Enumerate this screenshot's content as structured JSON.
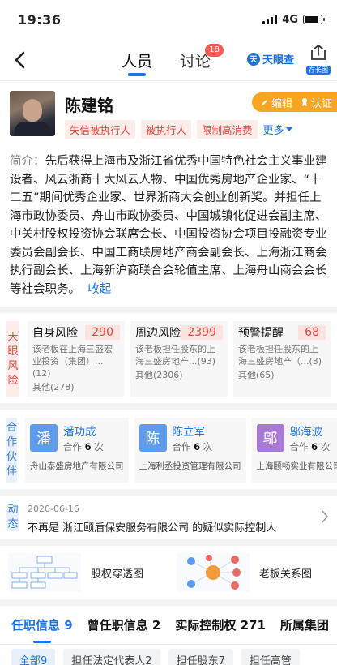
{
  "status": {
    "time": "19:36",
    "network": "4G",
    "battery_level": 0.85
  },
  "nav": {
    "tabs": [
      {
        "label": "人员",
        "active": true
      },
      {
        "label": "讨论",
        "badge": "18"
      }
    ],
    "brand": "天眼查",
    "longshot_label": "存长图"
  },
  "profile": {
    "name": "陈建铭",
    "actions": {
      "edit": "编辑",
      "verify": "认证"
    },
    "tags": [
      "失信被执行人",
      "被执行人",
      "限制高消费"
    ],
    "more": "更多",
    "bio_label": "简介：",
    "bio": "先后获得上海市及浙江省优秀中国特色社会主义事业建设者、风云浙商十大风云人物、中国优秀房地产企业家、“十二五”期间优秀企业家、世界浙商大会创业创新奖。并担任上海市政协委员、舟山市政协委员、中国城镇化促进会副主席、中关村股权投资协会联席会长、中国投资协会项目投融资专业委员会副会长、中国工商联房地产商会副会长、上海浙江商会执行副会长、上海新沪商联合会轮值主席、上海舟山商会会长等社会职务。",
    "collapse": "收起"
  },
  "risk": {
    "side_label": [
      "天",
      "眼",
      "风",
      "险"
    ],
    "items": [
      {
        "title": "自身风险",
        "count": "290",
        "desc": "该老板在上海三盛宏业投资（集团）...(12)",
        "other": "其他(278)"
      },
      {
        "title": "周边风险",
        "count": "2399",
        "desc": "该老板担任股东的上海三盛房地产...(93)",
        "other": "其他(2306)"
      },
      {
        "title": "预警提醒",
        "count": "68",
        "desc": "该老板担任股东的上海三盛房地产（...(3)",
        "other": "其他(65)"
      }
    ]
  },
  "partners": {
    "side_label": [
      "合",
      "作",
      "伙",
      "伴"
    ],
    "coop_prefix": "合作",
    "coop_suffix": "次",
    "items": [
      {
        "initial": "潘",
        "name": "潘功成",
        "times": "6",
        "company": "舟山泰盛房地产有限公司",
        "color": "#5d9cec"
      },
      {
        "initial": "陈",
        "name": "陈立军",
        "times": "6",
        "company": "上海利丞投资管理有限公司",
        "color": "#5d9cec"
      },
      {
        "initial": "邬",
        "name": "邬海波",
        "times": "6",
        "company": "上海颐畅实业有限公司",
        "color": "#a979d6"
      }
    ]
  },
  "dynamic": {
    "side_label": [
      "动",
      "态"
    ],
    "date": "2020-06-16",
    "text": "不再是 浙江颐盾保安服务有限公司 的疑似实际控制人"
  },
  "graphs": [
    {
      "label": "股权穿透图"
    },
    {
      "label": "老板关系图"
    }
  ],
  "tabs": [
    {
      "label": "任职信息 9",
      "active": true
    },
    {
      "label": "曾任职信息 2"
    },
    {
      "label": "实际控制权 271"
    },
    {
      "label": "所属集团"
    }
  ],
  "chips": [
    {
      "label": "全部9",
      "active": true
    },
    {
      "label": "担任法定代表人2"
    },
    {
      "label": "担任股东7"
    },
    {
      "label": "担任高管"
    }
  ]
}
